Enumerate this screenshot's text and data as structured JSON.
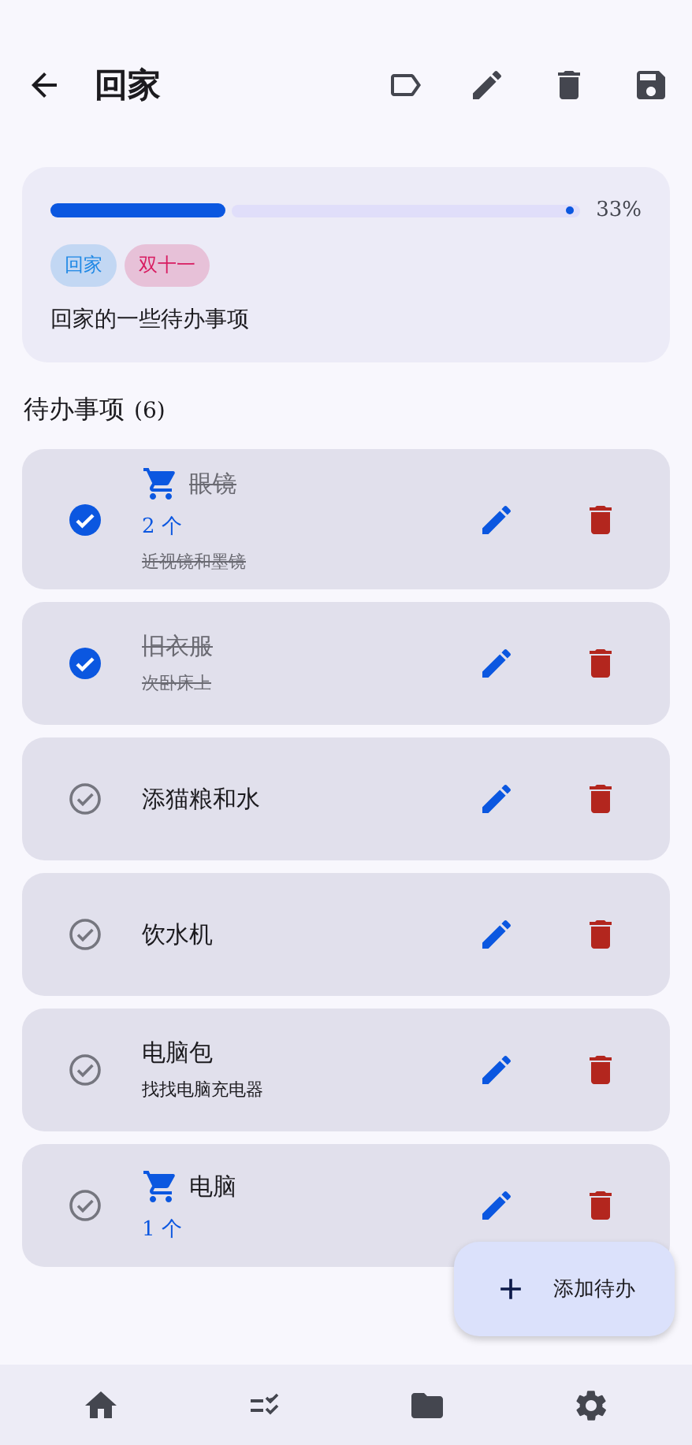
{
  "header": {
    "title": "回家"
  },
  "summary": {
    "progress": {
      "level": 0.33,
      "reading": "33%"
    },
    "tags": [
      {
        "label": "回家",
        "color": "#1e88e5"
      },
      {
        "label": "双十一",
        "color": "#d81b60"
      }
    ],
    "description": "回家的一些待办事项"
  },
  "section": {
    "title": "待办事项",
    "count": "(6)"
  },
  "todos": [
    {
      "checked": true,
      "kind": "shopping",
      "title": "眼镜",
      "quantity": "2 个",
      "note": "近视镜和墨镜"
    },
    {
      "checked": true,
      "kind": "plain",
      "title": "旧衣服",
      "note": "次卧床上"
    },
    {
      "checked": false,
      "kind": "plain",
      "title": "添猫粮和水"
    },
    {
      "checked": false,
      "kind": "plain",
      "title": "饮水机"
    },
    {
      "checked": false,
      "kind": "plain",
      "title": "电脑包",
      "note": "找找电脑充电器"
    },
    {
      "checked": false,
      "kind": "shopping",
      "title": "电脑",
      "quantity": "1 个"
    }
  ],
  "fab": {
    "label": "添加待办"
  }
}
